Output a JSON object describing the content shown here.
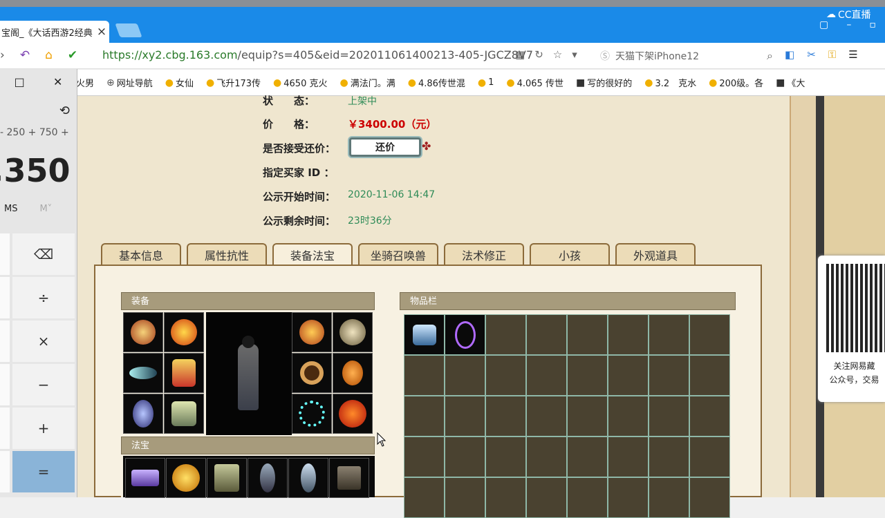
{
  "browser": {
    "tab_title": "宝阁_《大话西游2经典",
    "brand": "CC直播",
    "url_main": "https://xy2.cbg.163.com",
    "url_rest": "/equip?s=405&eid=202011061400213-405-JGCZ8V7",
    "search_text": "天猫下架iPhone12"
  },
  "bookmarks": [
    "火男",
    "网址导航",
    "女仙",
    "飞升173传",
    "4650 克火",
    "满法门。满",
    "4.86传世混",
    "1",
    "4.065 传世",
    "写的很好的",
    "3.2　克水",
    "200级。各",
    "《大"
  ],
  "calculator": {
    "expression": "- 250 + 750 +",
    "result": ",350",
    "mem_ms": "MS",
    "mem_m": "M˅",
    "keys": [
      "⌫",
      "÷",
      "×",
      "−",
      "+",
      "="
    ]
  },
  "info": {
    "status_label": "状　　态：",
    "status_value": "上架中",
    "price_label": "价　　格：",
    "price_value": "￥3400.00（元）",
    "offer_label": "是否接受还价：",
    "offer_button": "还价",
    "buyer_label": "指定买家 ID ：",
    "start_label": "公示开始时间：",
    "start_value": "2020-11-06 14:47",
    "remain_label": "公示剩余时间：",
    "remain_value": "23时36分"
  },
  "tabs": [
    "基本信息",
    "属性抗性",
    "装备法宝",
    "坐骑召唤兽",
    "法术修正",
    "小孩",
    "外观道具"
  ],
  "equip_panel": {
    "title": "装备",
    "fabao_title": "法宝"
  },
  "inventory_panel": {
    "title": "物品栏"
  },
  "qr": {
    "line1": "关注网易藏",
    "line2": "公众号，交易"
  },
  "colors": {
    "price": "#cc0000",
    "green_value": "#2e8b57",
    "accent_tab": "#1a8ae8"
  }
}
